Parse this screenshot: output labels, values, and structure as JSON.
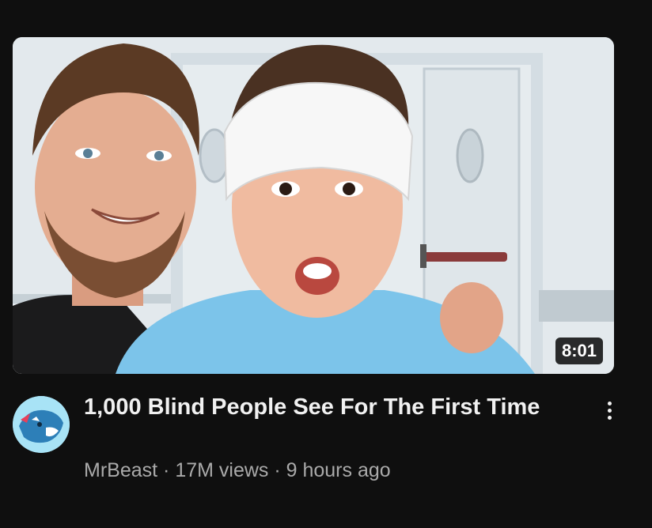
{
  "video": {
    "title": "1,000 Blind People See For The First Time",
    "duration": "8:01",
    "channel": "MrBeast",
    "separator": " · ",
    "views": "17M views",
    "age": "9 hours ago"
  },
  "icons": {
    "avatar": "mrbeast-panther-logo",
    "menu": "more-vertical-icon"
  },
  "colors": {
    "background": "#0f0f0f",
    "title": "#f1f1f1",
    "secondary_text": "#aaaaaa",
    "avatar_bg": "#a8e3f6"
  }
}
